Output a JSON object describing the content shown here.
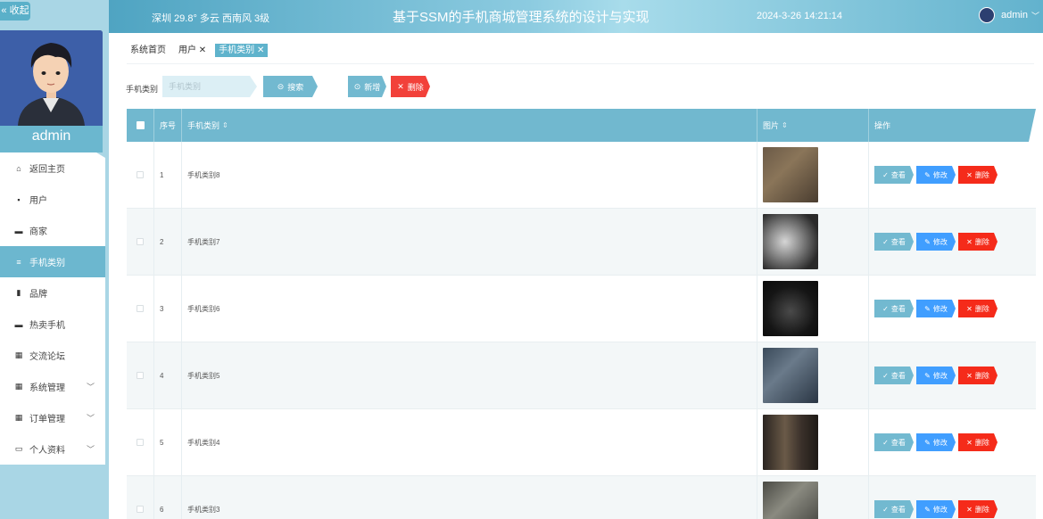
{
  "sidebar": {
    "collapse_label": "« 收起",
    "admin_name": "admin",
    "menu": [
      {
        "label": "返回主页",
        "icon": "⌂"
      },
      {
        "label": "用户",
        "icon": "▪"
      },
      {
        "label": "商家",
        "icon": "▬"
      },
      {
        "label": "手机类别",
        "icon": "≡"
      },
      {
        "label": "品牌",
        "icon": "▮"
      },
      {
        "label": "热卖手机",
        "icon": "▬"
      },
      {
        "label": "交流论坛",
        "icon": "▦"
      },
      {
        "label": "系统管理",
        "icon": "▦"
      },
      {
        "label": "订单管理",
        "icon": "▦"
      },
      {
        "label": "个人资料",
        "icon": "▭"
      }
    ]
  },
  "header": {
    "weather": "深圳  29.8°  多云  西南风  3级",
    "title": "基于SSM的手机商城管理系统的设计与实现",
    "datetime": "2024-3-26 14:21:14",
    "user": "admin"
  },
  "tabs": [
    "系统首页",
    "用户 ✕",
    "手机类别 ✕"
  ],
  "search": {
    "label": "手机类别",
    "placeholder": "手机类别",
    "search_btn": "搜索",
    "add_btn": "新增",
    "delete_btn": "删除"
  },
  "table": {
    "headers": {
      "index": "序号",
      "name": "手机类别",
      "image": "图片",
      "ops": "操作"
    },
    "rows": [
      {
        "index": "1",
        "name": "手机类别8"
      },
      {
        "index": "2",
        "name": "手机类别7"
      },
      {
        "index": "3",
        "name": "手机类别6"
      },
      {
        "index": "4",
        "name": "手机类别5"
      },
      {
        "index": "5",
        "name": "手机类别4"
      },
      {
        "index": "6",
        "name": "手机类别3"
      }
    ],
    "ops": {
      "view": "查看",
      "edit": "修改",
      "delete": "删除"
    }
  },
  "colors": {
    "accent": "#6cb7cf",
    "danger": "#f52b1a",
    "primary": "#409eff"
  }
}
